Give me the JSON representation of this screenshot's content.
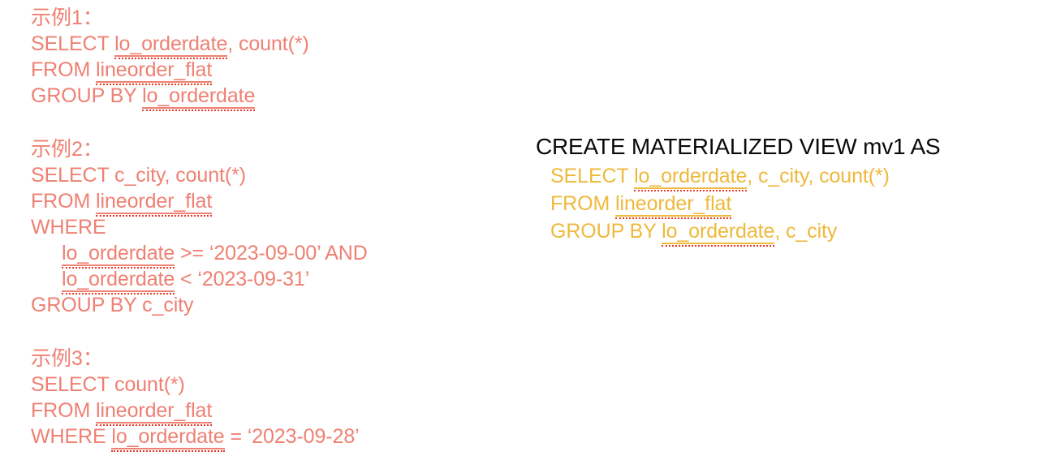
{
  "colors": {
    "background": "#ffffff",
    "example_text": "#ef8073",
    "mv_title_text": "#0a0a0a",
    "mv_body_text": "#eeb93c",
    "spellcheck_underline": "#e8382a"
  },
  "examples": [
    {
      "heading": "示例1：",
      "lines": [
        {
          "indent": false,
          "parts": [
            {
              "t": "SELECT ",
              "ident": false
            },
            {
              "t": "lo_orderdate",
              "ident": true
            },
            {
              "t": ", count(*)",
              "ident": false
            }
          ]
        },
        {
          "indent": false,
          "parts": [
            {
              "t": "FROM ",
              "ident": false
            },
            {
              "t": "lineorder_flat",
              "ident": true
            }
          ]
        },
        {
          "indent": false,
          "parts": [
            {
              "t": "GROUP BY ",
              "ident": false
            },
            {
              "t": "lo_orderdate",
              "ident": true
            }
          ]
        }
      ]
    },
    {
      "heading": "示例2：",
      "lines": [
        {
          "indent": false,
          "parts": [
            {
              "t": "SELECT c_city, count(*)",
              "ident": false
            }
          ]
        },
        {
          "indent": false,
          "parts": [
            {
              "t": "FROM ",
              "ident": false
            },
            {
              "t": "lineorder_flat",
              "ident": true
            }
          ]
        },
        {
          "indent": false,
          "parts": [
            {
              "t": "WHERE",
              "ident": false
            }
          ]
        },
        {
          "indent": true,
          "parts": [
            {
              "t": "lo_orderdate",
              "ident": true
            },
            {
              "t": " >= ‘2023-09-00’ AND",
              "ident": false
            }
          ]
        },
        {
          "indent": true,
          "parts": [
            {
              "t": "lo_orderdate",
              "ident": true
            },
            {
              "t": " < ‘2023-09-31’",
              "ident": false
            }
          ]
        },
        {
          "indent": false,
          "parts": [
            {
              "t": "GROUP BY c_city",
              "ident": false
            }
          ]
        }
      ]
    },
    {
      "heading": "示例3：",
      "lines": [
        {
          "indent": false,
          "parts": [
            {
              "t": "SELECT count(*)",
              "ident": false
            }
          ]
        },
        {
          "indent": false,
          "parts": [
            {
              "t": "FROM ",
              "ident": false
            },
            {
              "t": "lineorder_flat",
              "ident": true
            }
          ]
        },
        {
          "indent": false,
          "parts": [
            {
              "t": "WHERE ",
              "ident": false
            },
            {
              "t": "lo_orderdate",
              "ident": true
            },
            {
              "t": " = ‘2023-09-28’",
              "ident": false
            }
          ]
        }
      ]
    }
  ],
  "materialized_view": {
    "title": "CREATE MATERIALIZED VIEW mv1 AS",
    "lines": [
      {
        "parts": [
          {
            "t": "SELECT ",
            "ident": false
          },
          {
            "t": "lo_orderdate",
            "ident": true
          },
          {
            "t": ", c_city, count(*)",
            "ident": false
          }
        ]
      },
      {
        "parts": [
          {
            "t": "FROM ",
            "ident": false
          },
          {
            "t": "lineorder_flat",
            "ident": true
          }
        ]
      },
      {
        "parts": [
          {
            "t": "GROUP BY ",
            "ident": false
          },
          {
            "t": "lo_orderdate",
            "ident": true
          },
          {
            "t": ", c_city",
            "ident": false
          }
        ]
      }
    ]
  }
}
